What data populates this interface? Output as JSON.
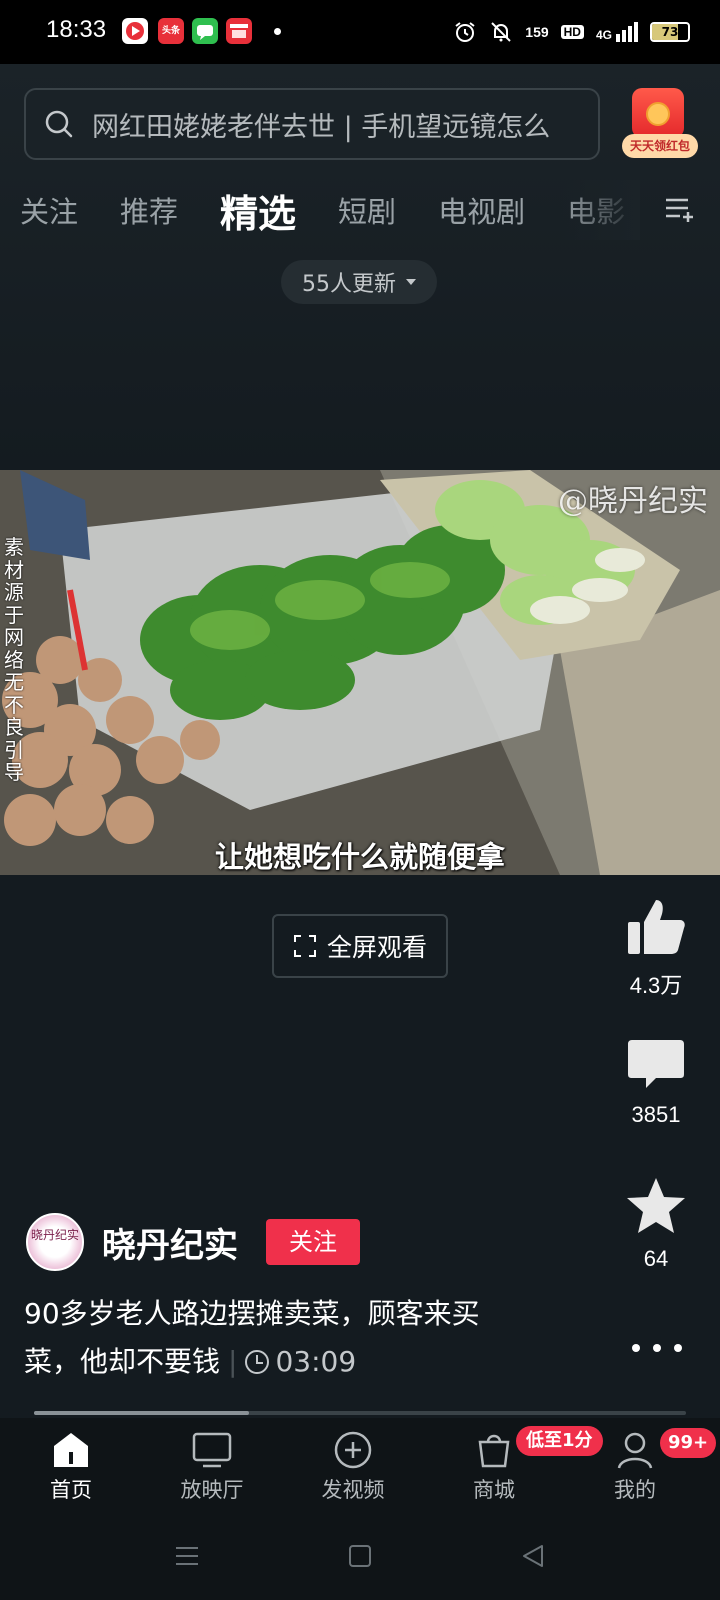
{
  "status_bar": {
    "time": "18:33",
    "apps": [
      {
        "name": "video-app-icon",
        "label": "",
        "color": "#e8303a"
      },
      {
        "name": "toutiao-app-icon",
        "label": "头条",
        "color": "#e8303a"
      },
      {
        "name": "message-app-icon",
        "label": "",
        "color": "#2fbf4f"
      },
      {
        "name": "shop-app-icon",
        "label": "",
        "color": "#e8303a"
      }
    ],
    "net_speed": "159",
    "hd_label": "HD",
    "network": "4G",
    "battery": "73",
    "battery_level": 0.73
  },
  "search": {
    "placeholder": "网红田姥姥老伴去世 | 手机望远镜怎么"
  },
  "red_packet": {
    "label": "天天领红包"
  },
  "tabs": [
    {
      "label": "关注",
      "active": false
    },
    {
      "label": "推荐",
      "active": false
    },
    {
      "label": "精选",
      "active": true
    },
    {
      "label": "短剧",
      "active": false
    },
    {
      "label": "电视剧",
      "active": false
    },
    {
      "label": "电影",
      "active": false
    }
  ],
  "update_pill": {
    "label": "55人更新"
  },
  "video": {
    "vertical_note": "素材源于网络无不良引导",
    "watermark": "@晓丹纪实",
    "subtitle": "让她想吃什么就随便拿"
  },
  "fullscreen": {
    "label": "全屏观看"
  },
  "actions": {
    "likes": "4.3万",
    "comments": "3851",
    "favorites": "64"
  },
  "author": {
    "avatar_text": "晓丹纪实",
    "name": "晓丹纪实",
    "follow_label": "关注"
  },
  "description": {
    "text": "90多岁老人路边摆摊卖菜，顾客来买菜，他却不要钱",
    "duration": "03:09"
  },
  "progress": {
    "played_fraction": 0.33
  },
  "bottom_nav": {
    "items": [
      {
        "label": "首页",
        "active": true
      },
      {
        "label": "放映厅",
        "active": false
      },
      {
        "label": "发视频",
        "active": false
      },
      {
        "label": "商城",
        "active": false,
        "badge": "低至1分"
      },
      {
        "label": "我的",
        "active": false,
        "badge": "99+"
      }
    ]
  },
  "colors": {
    "background": "#141b20",
    "accent_red": "#f0304b"
  }
}
